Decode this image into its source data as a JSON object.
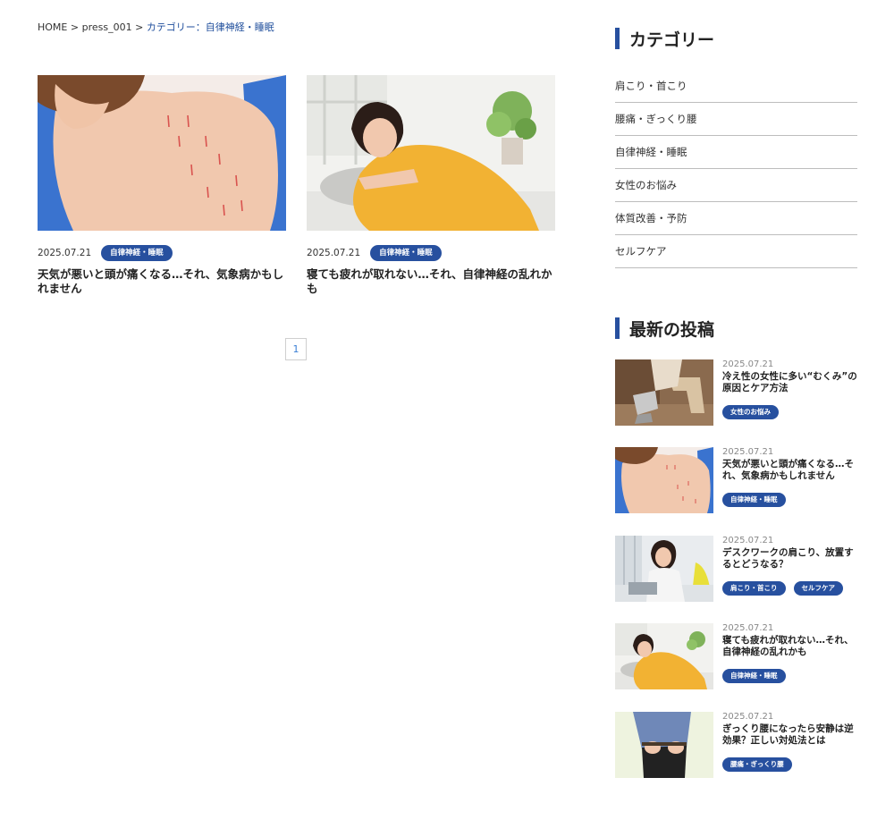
{
  "breadcrumb": {
    "home": "HOME",
    "sep1": ">",
    "parent": "press_001",
    "sep2": ">",
    "current": "カテゴリー：自律神経・睡眠"
  },
  "articles": [
    {
      "date": "2025.07.21",
      "tag": "自律神経・睡眠",
      "title": "天気が悪いと頭が痛くなる…それ、気象病かもしれません"
    },
    {
      "date": "2025.07.21",
      "tag": "自律神経・睡眠",
      "title": "寝ても疲れが取れない…それ、自律神経の乱れかも"
    }
  ],
  "pagination": {
    "current": "1"
  },
  "sidebar": {
    "categories_title": "カテゴリー",
    "categories": [
      "肩こり・首こり",
      "腰痛・ぎっくり腰",
      "自律神経・睡眠",
      "女性のお悩み",
      "体質改善・予防",
      "セルフケア"
    ],
    "recent_title": "最新の投稿",
    "recent_posts": [
      {
        "date": "2025.07.21",
        "title": "冷え性の女性に多い“むくみ”の原因とケア方法",
        "tags": [
          "女性のお悩み"
        ]
      },
      {
        "date": "2025.07.21",
        "title": "天気が悪いと頭が痛くなる…それ、気象病かもしれません",
        "tags": [
          "自律神経・睡眠"
        ]
      },
      {
        "date": "2025.07.21",
        "title": "デスクワークの肩こり、放置するとどうなる？",
        "tags": [
          "肩こり・首こり",
          "セルフケア"
        ]
      },
      {
        "date": "2025.07.21",
        "title": "寝ても疲れが取れない…それ、自律神経の乱れかも",
        "tags": [
          "自律神経・睡眠"
        ]
      },
      {
        "date": "2025.07.21",
        "title": "ぎっくり腰になったら安静は逆効果？正しい対処法とは",
        "tags": [
          "腰痛・ぎっくり腰"
        ]
      }
    ]
  },
  "colors": {
    "accent": "#27509f",
    "link": "#1f4e9c",
    "pager_text": "#3a7fd5"
  }
}
